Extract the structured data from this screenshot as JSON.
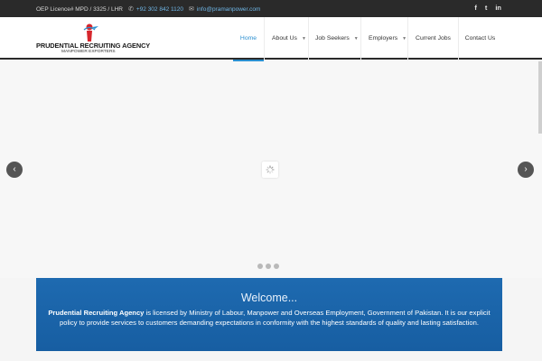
{
  "topbar": {
    "licence": "OEP Licence# MPD / 3325 / LHR",
    "phone": "+92 302 842 1120",
    "email": "info@pramanpower.com",
    "social": [
      "f",
      "t",
      "in"
    ]
  },
  "brand": {
    "name": "PRUDENTIAL RECRUITING AGENCY",
    "tagline": "MANPOWER EXPORTERS"
  },
  "nav": [
    {
      "label": "Home",
      "active": true,
      "dropdown": false
    },
    {
      "label": "About Us",
      "active": false,
      "dropdown": true
    },
    {
      "label": "Job Seekers",
      "active": false,
      "dropdown": true
    },
    {
      "label": "Employers",
      "active": false,
      "dropdown": true
    },
    {
      "label": "Current Jobs",
      "active": false,
      "dropdown": false
    },
    {
      "label": "Contact Us",
      "active": false,
      "dropdown": false
    }
  ],
  "slider": {
    "prev_icon": "chevron-left-icon",
    "next_icon": "chevron-right-icon",
    "dot_count": 3
  },
  "welcome": {
    "title": "Welcome...",
    "company": "Prudential Recruiting Agency",
    "text": " is licensed by Ministry of Labour, Manpower and Overseas Employment, Government of Pakistan. It is our explicit policy to provide services to customers demanding expectations in conformity with the highest standards of quality and lasting satisfaction."
  },
  "colors": {
    "accent": "#2a8fd0",
    "topbar": "#2a2a2a",
    "welcome_bg": "#1e6ab0"
  }
}
